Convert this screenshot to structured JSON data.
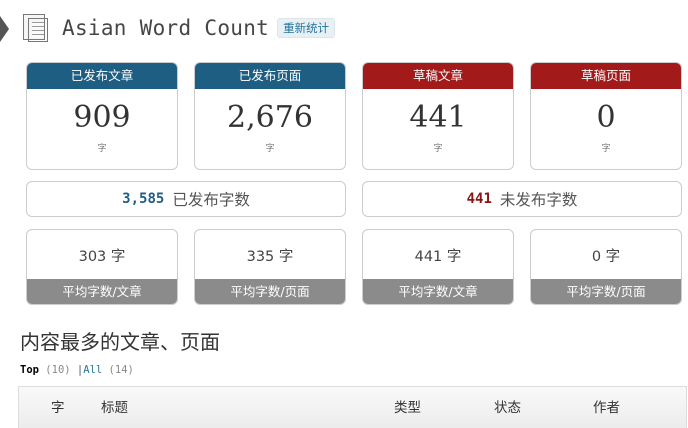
{
  "header": {
    "title": "Asian Word Count",
    "recount_label": "重新统计"
  },
  "cards": [
    {
      "label": "已发布文章",
      "value": "909",
      "unit": "字",
      "color": "#1f5e83"
    },
    {
      "label": "已发布页面",
      "value": "2,676",
      "unit": "字",
      "color": "#1f5e83"
    },
    {
      "label": "草稿文章",
      "value": "441",
      "unit": "字",
      "color": "#a21a1a"
    },
    {
      "label": "草稿页面",
      "value": "0",
      "unit": "字",
      "color": "#a21a1a"
    }
  ],
  "totals": {
    "published": {
      "value": "3,585",
      "label": "已发布字数"
    },
    "unpublished": {
      "value": "441",
      "label": "未发布字数"
    }
  },
  "averages": [
    {
      "value": "303 字",
      "label": "平均字数/文章"
    },
    {
      "value": "335 字",
      "label": "平均字数/页面"
    },
    {
      "value": "441 字",
      "label": "平均字数/文章"
    },
    {
      "value": "0 字",
      "label": "平均字数/页面"
    }
  ],
  "section": {
    "title": "内容最多的文章、页面",
    "filters": {
      "top_label": "Top",
      "top_count": "(10)",
      "separator": "|",
      "all_label": "All",
      "all_count": "(14)"
    }
  },
  "table": {
    "headers": [
      "字",
      "标题",
      "类型",
      "状态",
      "作者"
    ]
  },
  "icons": {
    "header": "document-pages-icon",
    "pointer": "arrow-pointer-icon"
  }
}
